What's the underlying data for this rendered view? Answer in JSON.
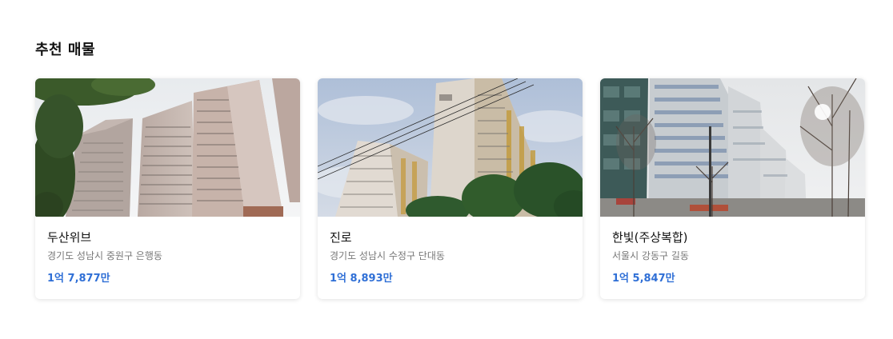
{
  "section": {
    "title": "추천 매물"
  },
  "listings": [
    {
      "name": "두산위브",
      "address": "경기도 성남시 중원구 은행동",
      "price": "1억 7,877만",
      "image_icon": "apartment-photo-icon"
    },
    {
      "name": "진로",
      "address": "경기도 성남시 수정구 단대동",
      "price": "1억 8,893만",
      "image_icon": "apartment-photo-icon"
    },
    {
      "name": "한빛(주상복합)",
      "address": "서울시 강동구 길동",
      "price": "1억 5,847만",
      "image_icon": "apartment-photo-icon"
    }
  ],
  "colors": {
    "price": "#2f6fd6",
    "title": "#111111",
    "address": "#777777"
  }
}
